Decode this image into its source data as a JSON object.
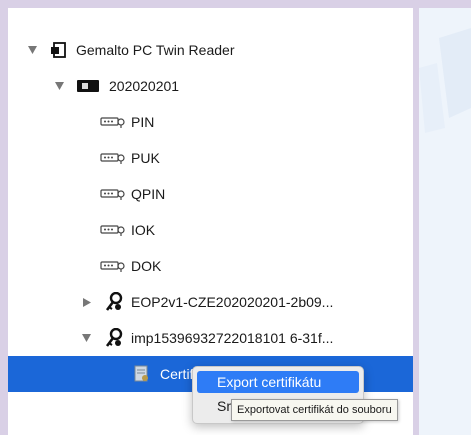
{
  "tree": {
    "reader": {
      "label": "Gemalto PC Twin Reader",
      "icon": "card-reader-icon"
    },
    "token": {
      "label": "202020201",
      "icon": "smart-card-icon"
    },
    "pins": [
      {
        "label": "PIN",
        "icon": "pin-keypad-icon"
      },
      {
        "label": "PUK",
        "icon": "pin-keypad-icon"
      },
      {
        "label": "QPIN",
        "icon": "pin-keypad-icon"
      },
      {
        "label": "IOK",
        "icon": "pin-keypad-icon"
      },
      {
        "label": "DOK",
        "icon": "pin-keypad-icon"
      }
    ],
    "keys": [
      {
        "label": "EOP2v1-CZE202020201-2b09...",
        "icon": "key-icon",
        "expanded": false
      },
      {
        "label": "imp15396932722018101 6-31f...",
        "icon": "key-icon",
        "expanded": true
      }
    ],
    "certificate": {
      "label": "Certifikát",
      "icon": "certificate-icon"
    }
  },
  "context_menu": {
    "items": [
      {
        "label": "Export certifikátu",
        "highlighted": true
      },
      {
        "label": "Sm"
      }
    ]
  },
  "tooltip": {
    "text": "Exportovat certifikát do souboru"
  },
  "colors": {
    "selection": "#1b67d8",
    "menu_highlight": "#2e7cf6",
    "background": "#d9d0e6"
  }
}
